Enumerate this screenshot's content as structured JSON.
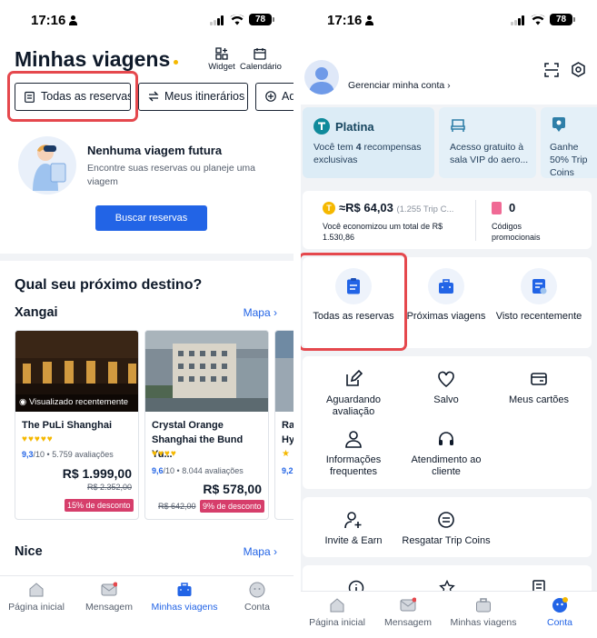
{
  "status_left": {
    "time": "17:16",
    "battery": "78"
  },
  "status_right": {
    "time": "17:16",
    "battery": "78"
  },
  "left": {
    "title": "Minhas viagens",
    "top_actions": [
      {
        "label": "Widget",
        "icon": "widget-icon"
      },
      {
        "label": "Calendário",
        "icon": "calendar-icon"
      }
    ],
    "chips": [
      {
        "label": "Todas as reservas",
        "icon": "clipboard-icon"
      },
      {
        "label": "Meus itinerários",
        "icon": "swap-icon"
      },
      {
        "label": "Ad",
        "icon": "plus-circle-icon"
      }
    ],
    "empty": {
      "heading": "Nenhuma viagem futura",
      "text": "Encontre suas reservas ou planeje uma viagem",
      "button": "Buscar reservas"
    },
    "next_destination": "Qual seu próximo destino?",
    "city1": "Xangai",
    "map_link": "Mapa",
    "city2": "Nice",
    "hotels": [
      {
        "badge": "Visualizado recentemente",
        "name": "The PuLi Shanghai",
        "stars": "♥♥♥♥♥",
        "score": "9,3",
        "scale": "/10",
        "reviews": "• 5.759 avaliações",
        "price": "R$ 1.999,00",
        "old": "R$ 2.352,00",
        "discount": "15% de desconto"
      },
      {
        "badge": "",
        "name": "Crystal Orange Shanghai the Bund Yu...",
        "stars": "♥♥♥♥",
        "score": "9,6",
        "scale": "/10",
        "reviews": "• 8.044 avaliações",
        "price": "R$ 578,00",
        "old": "R$ 642,00",
        "discount": "9% de desconto"
      },
      {
        "badge": "",
        "name": "Ra Hy",
        "stars": "★",
        "score": "9,2",
        "scale": "",
        "reviews": "",
        "price": "",
        "old": "",
        "discount": ""
      }
    ],
    "tabs": [
      {
        "label": "Página inicial",
        "icon": "home-icon"
      },
      {
        "label": "Mensagem",
        "icon": "message-icon"
      },
      {
        "label": "Minhas viagens",
        "icon": "suitcase-icon"
      },
      {
        "label": "Conta",
        "icon": "account-icon"
      }
    ]
  },
  "right": {
    "manage_account": "Gerenciar minha conta",
    "promos": [
      {
        "title": "Platina",
        "text_pre": "Você tem ",
        "text_bold": "4",
        "text_post": " recompensas exclusivas",
        "icon": "platinum-t-icon"
      },
      {
        "title": "",
        "text_pre": "Acesso gratuito à sala VIP do aero...",
        "text_bold": "",
        "text_post": "",
        "icon": "lounge-chair-icon"
      },
      {
        "title": "",
        "text_pre": "Ganhe 50% Trip Coins",
        "text_bold": "",
        "text_post": "",
        "icon": "chat-badge-icon"
      }
    ],
    "coins": {
      "amount": "≈R$ 64,03",
      "detail": "(1.255 Trip C...",
      "saved": "Você economizou um total de R$ 1.530,86"
    },
    "codes": {
      "count": "0",
      "label": "Códigos promocionais"
    },
    "row1": [
      {
        "label": "Todas as reservas",
        "icon": "clipboard-icon"
      },
      {
        "label": "Próximas viagens",
        "icon": "suitcase-icon"
      },
      {
        "label": "Visto recentemente",
        "icon": "recent-icon"
      }
    ],
    "row2": [
      {
        "label": "Aguardando avaliação",
        "icon": "edit-icon"
      },
      {
        "label": "Salvo",
        "icon": "heart-icon"
      },
      {
        "label": "Meus cartões",
        "icon": "card-icon"
      }
    ],
    "row3": [
      {
        "label": "Informações frequentes",
        "icon": "person-icon"
      },
      {
        "label": "Atendimento ao cliente",
        "icon": "headset-icon"
      }
    ],
    "row4": [
      {
        "label": "Invite & Earn",
        "icon": "add-person-icon"
      },
      {
        "label": "Resgatar Trip Coins",
        "icon": "coin-swap-icon"
      }
    ],
    "tabs": [
      {
        "label": "Página inicial",
        "icon": "home-icon"
      },
      {
        "label": "Mensagem",
        "icon": "message-icon"
      },
      {
        "label": "Minhas viagens",
        "icon": "suitcase-icon"
      },
      {
        "label": "Conta",
        "icon": "account-icon"
      }
    ]
  },
  "colors": {
    "accent": "#2264e6",
    "highlight": "#e5484d",
    "star": "#f5b800",
    "discount": "#d63e6b"
  }
}
